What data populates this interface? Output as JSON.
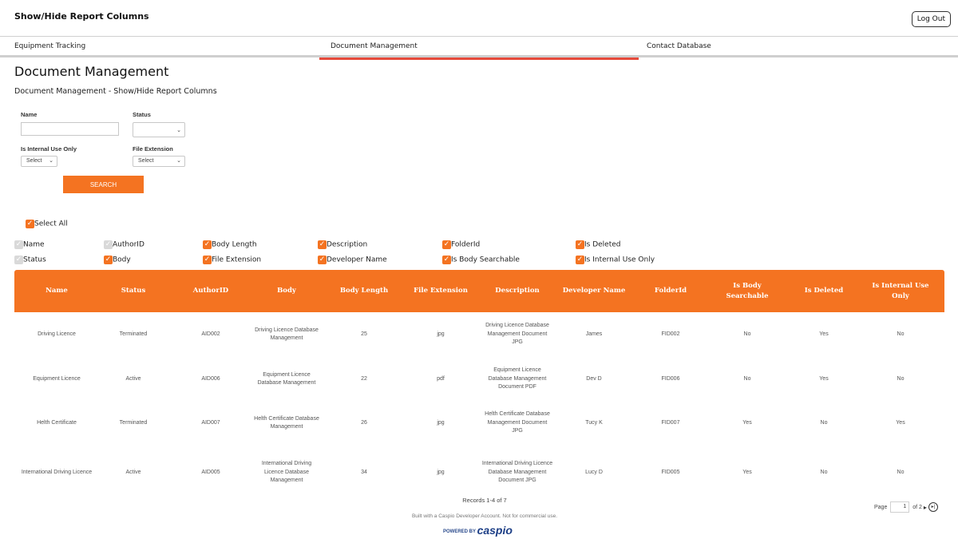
{
  "app": {
    "title": "Show/Hide Report Columns",
    "logout_label": "Log Out"
  },
  "tabs": [
    {
      "label": "Equipment Tracking"
    },
    {
      "label": "Document Management"
    },
    {
      "label": "Contact Database"
    }
  ],
  "page": {
    "title": "Document Management",
    "subtitle": "Document Management - Show/Hide Report Columns"
  },
  "search": {
    "name_label": "Name",
    "name_value": "",
    "status_label": "Status",
    "status_value": "",
    "internal_label": "Is Internal Use Only",
    "internal_value": "Select",
    "extension_label": "File Extension",
    "extension_value": "Select",
    "button_label": "SEARCH"
  },
  "columns_toggle": {
    "select_all_label": "Select All",
    "items": [
      {
        "label": "Name"
      },
      {
        "label": "AuthorID"
      },
      {
        "label": "Body Length"
      },
      {
        "label": "Description"
      },
      {
        "label": "FolderId"
      },
      {
        "label": "Is Deleted"
      },
      {
        "label": "Status"
      },
      {
        "label": "Body"
      },
      {
        "label": "File Extension"
      },
      {
        "label": "Developer Name"
      },
      {
        "label": "Is Body Searchable"
      },
      {
        "label": "Is Internal Use Only"
      }
    ]
  },
  "table": {
    "headers": [
      "Name",
      "Status",
      "AuthorID",
      "Body",
      "Body Length",
      "File Extension",
      "Description",
      "Developer Name",
      "FolderId",
      "Is Body Searchable",
      "Is Deleted",
      "Is Internal Use Only"
    ],
    "rows": [
      [
        "Driving Licence",
        "Terminated",
        "AID002",
        "Driving Licence Database Management",
        "25",
        "jpg",
        "Driving Licence Database Management Document JPG",
        "James",
        "FID002",
        "No",
        "Yes",
        "No"
      ],
      [
        "Equipment Licence",
        "Active",
        "AID006",
        "Equipment Licence Database Management",
        "22",
        "pdf",
        "Equipment Licence Database Management Document PDF",
        "Dev D",
        "FID006",
        "No",
        "Yes",
        "No"
      ],
      [
        "Helth Certificate",
        "Terminated",
        "AID007",
        "Helth Certificate Database Management",
        "26",
        "jpg",
        "Helth Certificate Database Management Document JPG",
        "Tucy K",
        "FID007",
        "Yes",
        "No",
        "Yes"
      ],
      [
        "International Driving Licence",
        "Active",
        "AID005",
        "International Driving Licence Database Management",
        "34",
        "jpg",
        "International Driving Licence Database Management Document JPG",
        "Lucy D",
        "FID005",
        "Yes",
        "No",
        "No"
      ]
    ]
  },
  "footer": {
    "records": "Records 1-4 of 7",
    "note": "Built with a Caspio Developer Account. Not for commercial use.",
    "powered_by": "POWERED BY",
    "brand": "caspio"
  },
  "pager": {
    "page_label": "Page",
    "page_value": "1",
    "of_label": "of 2"
  },
  "colors": {
    "accent": "#f47321",
    "tab_active": "#e64a3b"
  }
}
